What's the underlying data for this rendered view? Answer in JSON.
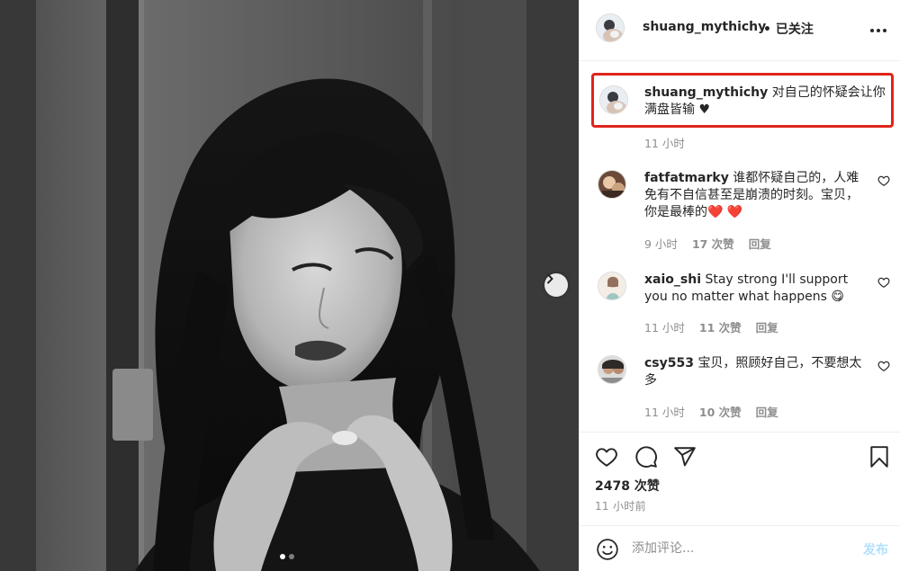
{
  "colors": {
    "accent_red": "#e0241c",
    "text": "#262626",
    "muted": "#8e8e8e",
    "post_disabled": "#b2dffc",
    "heart": "#ed4956"
  },
  "photo": {
    "alt_icon": "chevron-right-icon",
    "carousel": {
      "count": 2,
      "active": 1
    }
  },
  "header": {
    "username": "shuang_mythichy",
    "follow_status": "• 已关注",
    "more_icon": "more-horizontal-icon"
  },
  "caption": {
    "username": "shuang_mythichy",
    "text": "对自己的怀疑会让你满盘皆输 ♥",
    "time": "11 小时"
  },
  "comments": [
    {
      "username": "fatfatmarky",
      "text": "谁都怀疑自己的，人难免有不自信甚至是崩溃的时刻。宝贝，你是最棒的❤️ ❤️",
      "time": "9 小时",
      "likes": "17 次赞",
      "reply": "回复"
    },
    {
      "username": "xaio_shi",
      "text": "Stay strong I'll support you no matter what happens 😋",
      "time": "11 小时",
      "likes": "11 次赞",
      "reply": "回复"
    },
    {
      "username": "csy553",
      "text": "宝贝，照顾好自己，不要想太多",
      "time": "11 小时",
      "likes": "10 次赞",
      "reply": "回复"
    }
  ],
  "actions": {
    "like_icon": "heart-icon",
    "comment_icon": "comment-icon",
    "share_icon": "send-icon",
    "save_icon": "bookmark-icon"
  },
  "likes_total": "2478 次赞",
  "posted_ago": "11 小时前",
  "comment_box": {
    "placeholder": "添加评论...",
    "post_label": "发布"
  }
}
